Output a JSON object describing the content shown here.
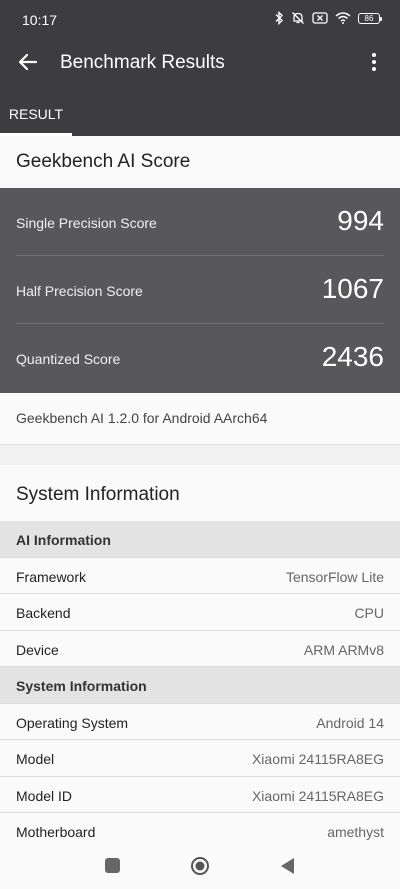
{
  "status": {
    "time": "10:17",
    "battery": "86"
  },
  "appbar": {
    "title": "Benchmark Results"
  },
  "tabs": [
    {
      "label": "RESULT"
    }
  ],
  "scores": {
    "heading": "Geekbench AI Score",
    "items": [
      {
        "label": "Single Precision Score",
        "value": "994"
      },
      {
        "label": "Half Precision Score",
        "value": "1067"
      },
      {
        "label": "Quantized Score",
        "value": "2436"
      }
    ],
    "version": "Geekbench AI 1.2.0 for Android AArch64"
  },
  "system": {
    "heading": "System Information",
    "rows": [
      {
        "key": "AI Information",
        "section": true
      },
      {
        "key": "Framework",
        "value": "TensorFlow Lite"
      },
      {
        "key": "Backend",
        "value": "CPU"
      },
      {
        "key": "Device",
        "value": "ARM ARMv8"
      },
      {
        "key": "System Information",
        "section": true
      },
      {
        "key": "Operating System",
        "value": "Android 14"
      },
      {
        "key": "Model",
        "value": "Xiaomi 24115RA8EG"
      },
      {
        "key": "Model ID",
        "value": "Xiaomi 24115RA8EG"
      },
      {
        "key": "Motherboard",
        "value": "amethyst"
      }
    ]
  }
}
